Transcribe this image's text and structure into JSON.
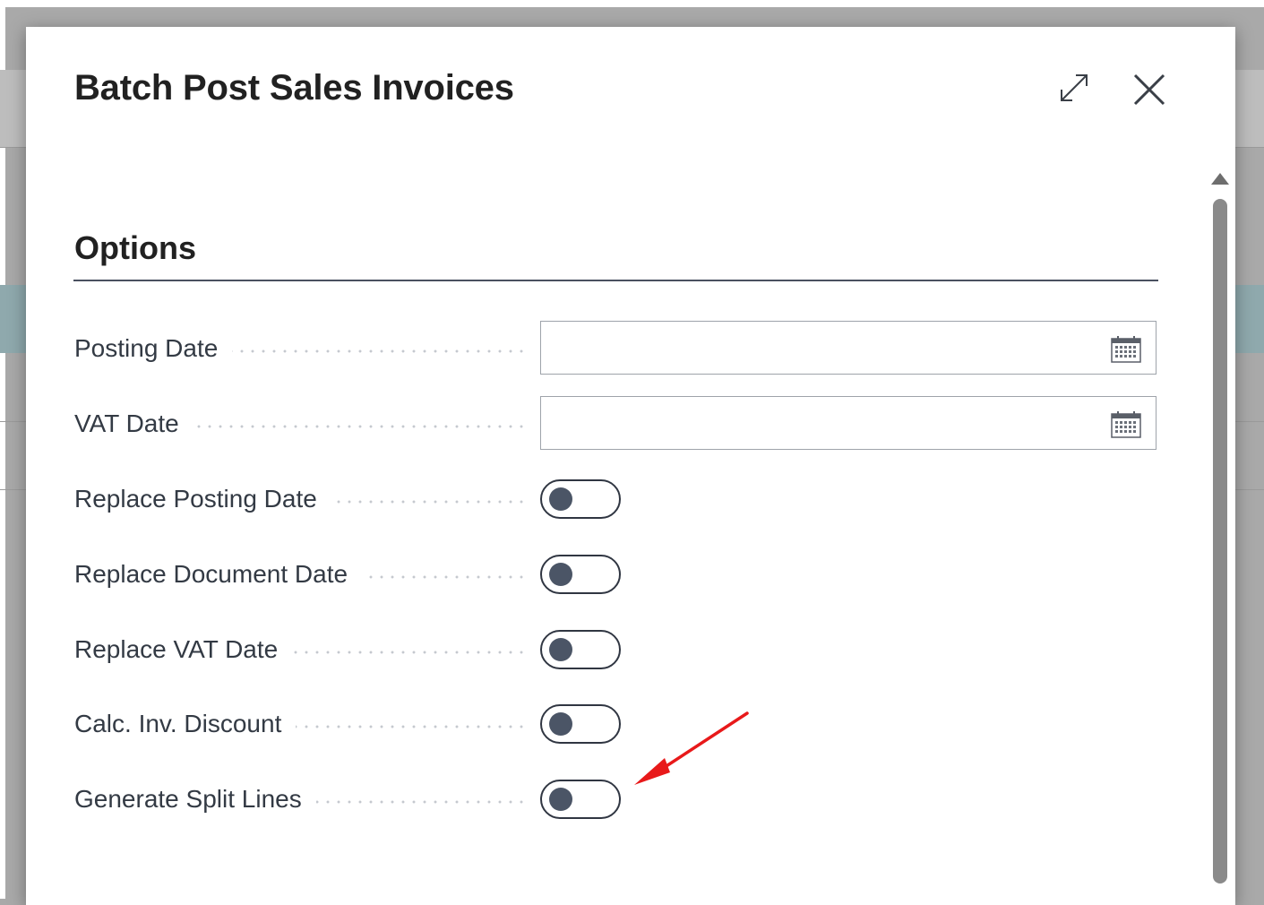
{
  "dialog": {
    "title": "Batch Post Sales Invoices",
    "expand_icon": "expand-arrows-icon",
    "close_icon": "close-icon"
  },
  "options": {
    "heading": "Options",
    "date_fields": [
      {
        "label": "Posting Date",
        "value": "",
        "icon": "calendar-icon"
      },
      {
        "label": "VAT Date",
        "value": "",
        "icon": "calendar-icon"
      }
    ],
    "toggles": [
      {
        "label": "Replace Posting Date",
        "on": false
      },
      {
        "label": "Replace Document Date",
        "on": false
      },
      {
        "label": "Replace VAT Date",
        "on": false
      },
      {
        "label": "Calc. Inv. Discount",
        "on": false
      },
      {
        "label": "Generate Split Lines",
        "on": false
      }
    ]
  },
  "annotation": {
    "color": "#e8191a",
    "points_to": "Generate Split Lines"
  },
  "colors": {
    "toggle_knob": "#4b5566",
    "toggle_border": "#303642",
    "section_rule": "#4a5160",
    "label_text": "#333a44"
  }
}
